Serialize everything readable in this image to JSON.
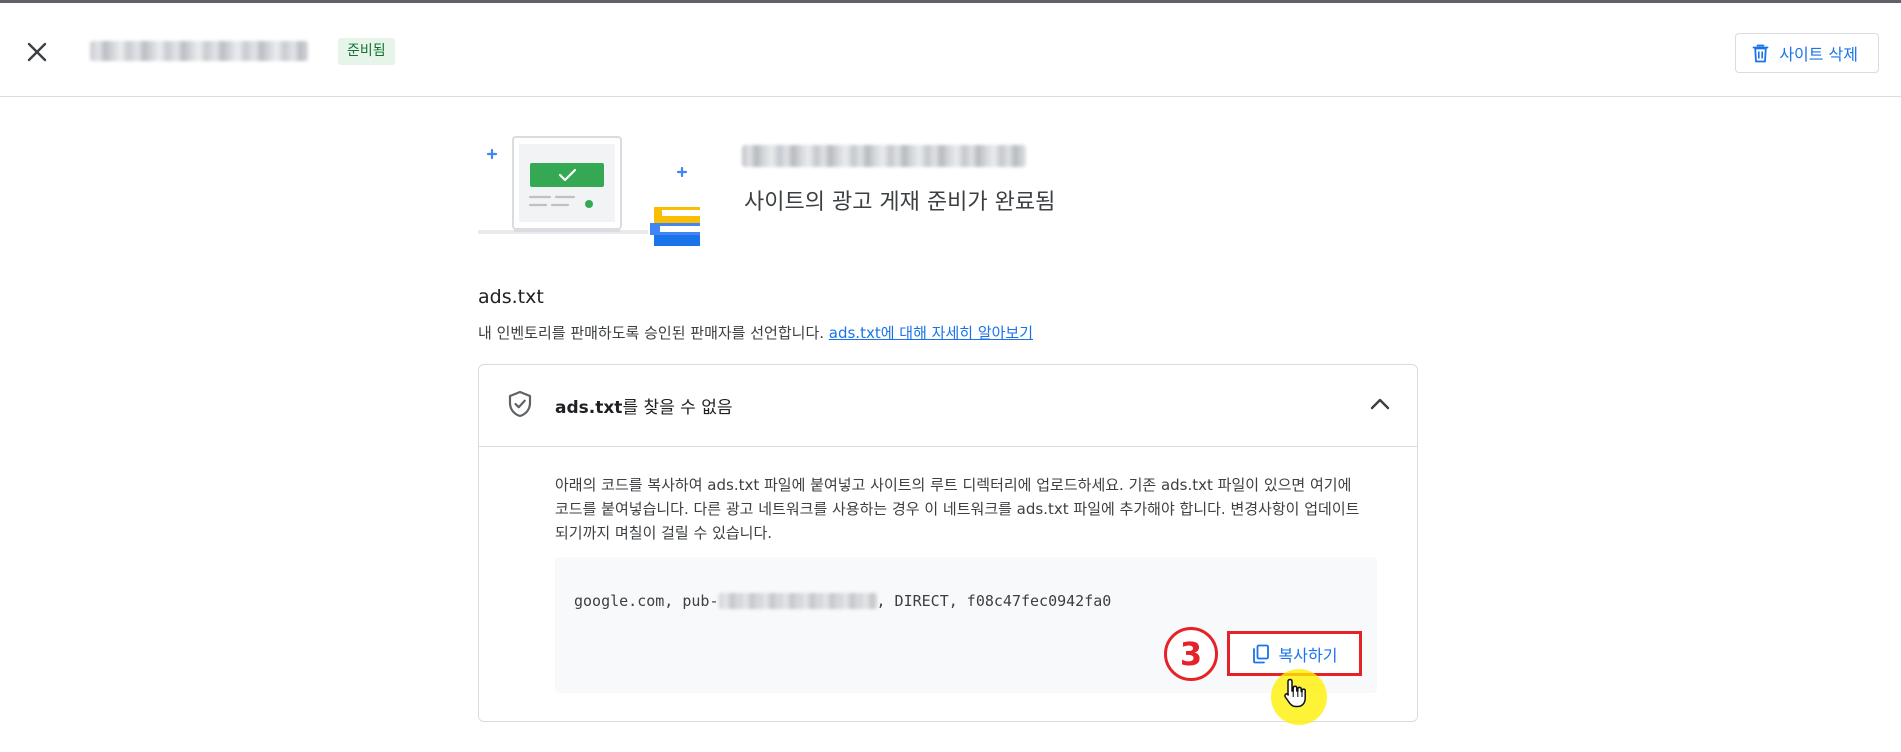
{
  "header": {
    "status_badge": "준비됨",
    "delete_label": "사이트 삭제"
  },
  "hero": {
    "title": "사이트의 광고 게재 준비가 완료됨"
  },
  "ads_txt": {
    "section_title": "ads.txt",
    "description": "내 인벤토리를 판매하도록 승인된 판매자를 선언합니다. ",
    "learn_more_link": "ads.txt에 대해 자세히 알아보기",
    "card_title_bold": "ads.txt",
    "card_title_rest": "를 찾을 수 없음",
    "instructions": "아래의 코드를 복사하여 ads.txt 파일에 붙여넣고 사이트의 루트 디렉터리에 업로드하세요. 기존 ads.txt 파일이 있으면 여기에 코드를 붙여넣습니다. 다른 광고 네트워크를 사용하는 경우 이 네트워크를 ads.txt 파일에 추가해야 합니다. 변경사항이 업데이트되기까지 며칠이 걸릴 수 있습니다.",
    "code_prefix": "google.com, pub-",
    "code_suffix": ", DIRECT, f08c47fec0942fa0",
    "copy_label": "복사하기"
  },
  "annotation": {
    "step_number": "3"
  },
  "icons": {
    "close": "close-icon",
    "delete": "trash-icon",
    "shield": "shield-check-icon",
    "collapse": "chevron-up-icon",
    "copy": "copy-icon",
    "cursor": "hand-pointer-icon"
  },
  "colors": {
    "accent": "#1a73e8",
    "badge_bg": "#e6f4ea",
    "badge_text": "#137333",
    "highlight_red": "#e52228",
    "cursor_halo": "#ffef00"
  }
}
